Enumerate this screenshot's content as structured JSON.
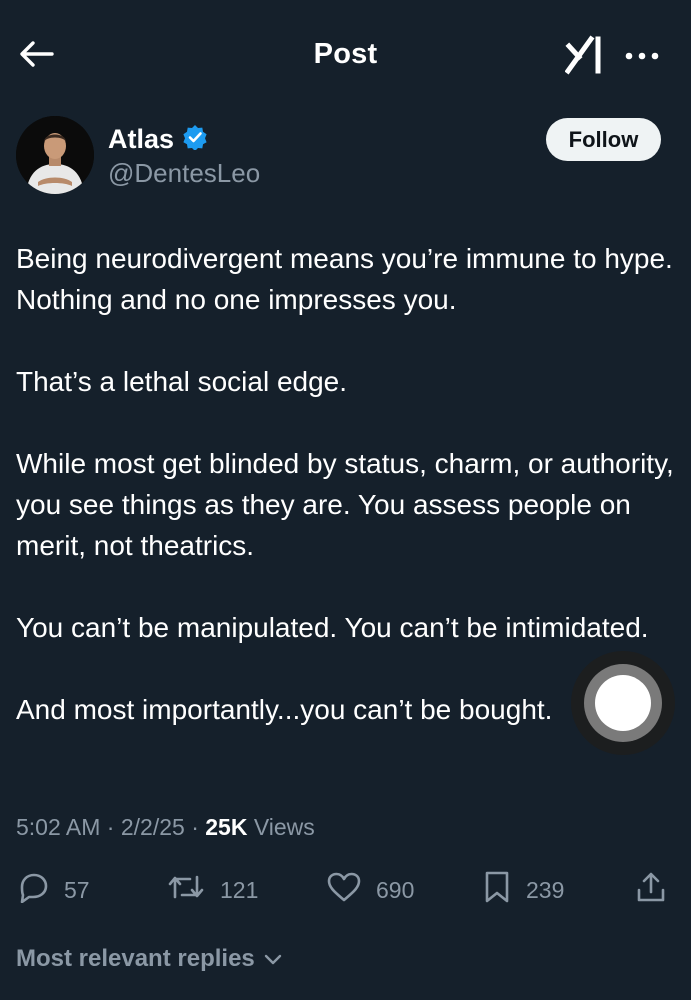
{
  "header": {
    "title": "Post",
    "back_icon": "arrow-left-icon",
    "grok_icon": "grok-icon",
    "more_icon": "ellipsis-icon"
  },
  "author": {
    "display_name": "Atlas",
    "handle": "@DentesLeo",
    "verified": true,
    "verified_color": "#1d9bf0",
    "follow_label": "Follow"
  },
  "post": {
    "paragraphs": [
      "Being neurodivergent means you’re immune to hype. Nothing and no one impresses you.",
      "That’s a lethal social edge.",
      "While most get blinded by status, charm, or authority, you see things as they are. You assess people on merit, not theatrics.",
      "You can’t be manipulated. You can’t be intimidated.",
      "And most importantly...you can’t be bought."
    ],
    "time": "5:02 AM",
    "date": "2/2/25",
    "separator": "·",
    "views_count": "25K",
    "views_label": "Views"
  },
  "actions": {
    "replies": "57",
    "reposts": "121",
    "likes": "690",
    "bookmarks": "239"
  },
  "replies_filter": {
    "label": "Most relevant replies"
  },
  "colors": {
    "background": "#15202b",
    "muted_text": "#8b98a5",
    "follow_bg": "#eff3f4"
  }
}
